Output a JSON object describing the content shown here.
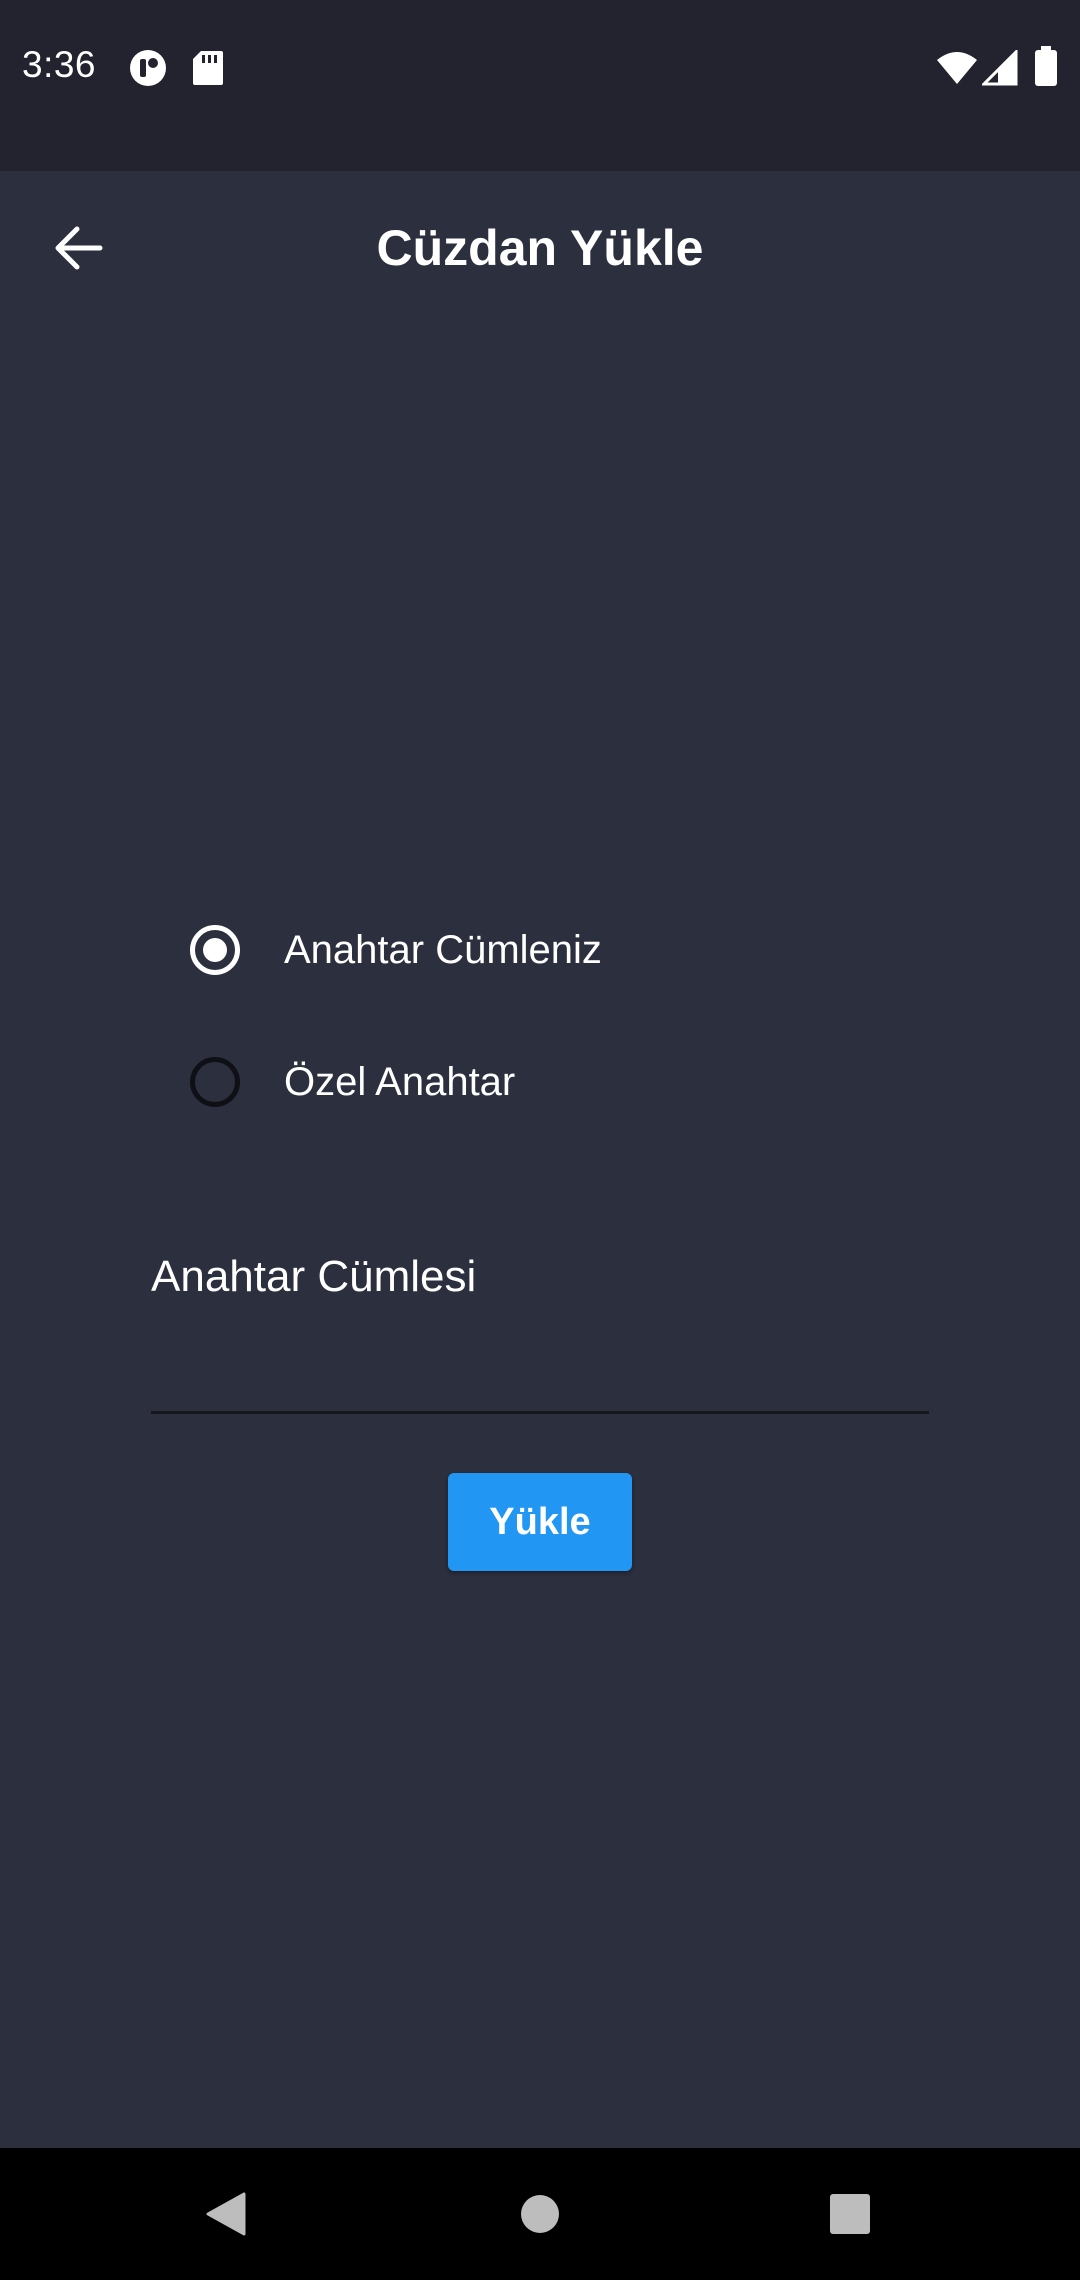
{
  "status_bar": {
    "time": "3:36",
    "left_icons": [
      "data-saver-icon",
      "sd-card-icon"
    ],
    "right_icons": [
      "wifi-icon",
      "cellular-signal-icon",
      "battery-icon"
    ]
  },
  "header": {
    "title": "Cüzdan Yükle",
    "back_icon": "arrow-left-icon"
  },
  "import_type": {
    "options": [
      {
        "label": "Anahtar Cümleniz",
        "selected": true
      },
      {
        "label": "Özel Anahtar",
        "selected": false
      }
    ]
  },
  "form": {
    "field_label": "Anahtar Cümlesi",
    "field_value": "",
    "submit_label": "Yükle"
  },
  "nav_bar": {
    "icons": [
      "back-triangle-icon",
      "home-circle-icon",
      "recents-square-icon"
    ]
  },
  "colors": {
    "background": "#2c2f3d",
    "status_bar": "#22232f",
    "accent": "#2196f3",
    "nav_bar": "#000000"
  }
}
